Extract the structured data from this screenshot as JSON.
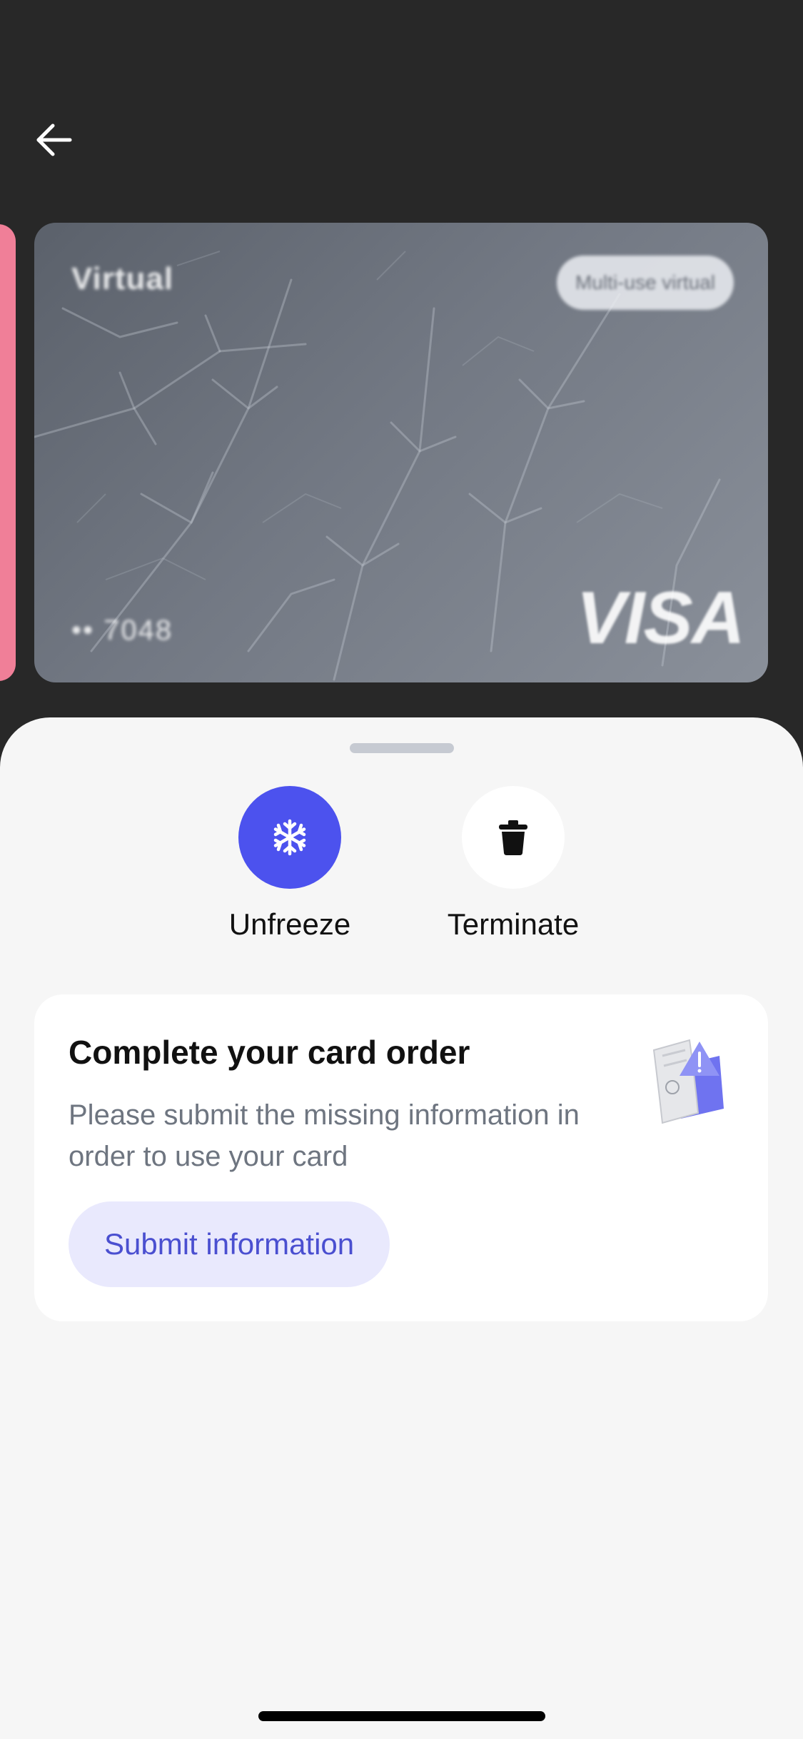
{
  "navigation": {
    "back_icon": "arrow-left-icon"
  },
  "card": {
    "name": "Virtual",
    "type_label": "Multi-use virtual",
    "last_digits": "•• 7048",
    "network": "VISA",
    "accent_prev_card": "#f07f98"
  },
  "actions": [
    {
      "label": "Unfreeze",
      "icon": "snowflake-icon",
      "bg": "#4c52ee"
    },
    {
      "label": "Terminate",
      "icon": "trash-icon",
      "bg": "#ffffff"
    }
  ],
  "info_card": {
    "title": "Complete your card order",
    "description": "Please submit the missing information in order to use your card",
    "button_label": "Submit information",
    "illustration": "document-warning-icon"
  },
  "colors": {
    "background": "#282828",
    "sheet": "#f6f6f6",
    "accent": "#4c52ee",
    "button_bg": "#e9e9fd",
    "button_text": "#4a4fd0"
  }
}
